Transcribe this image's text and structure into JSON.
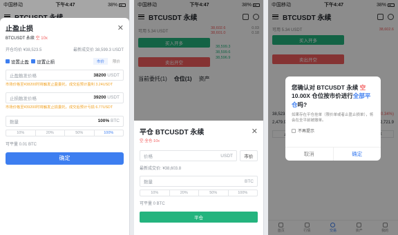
{
  "status": {
    "carrier": "中国移动",
    "time": "下午4:47",
    "battery": "38%"
  },
  "symbol": "BTCUSDT",
  "header": {
    "title": "BTCUSDT 永续"
  },
  "sl_dialog": {
    "title": "止盈止损",
    "subtitle_symbol": "BTCUSDT 永续",
    "subtitle_side": "空 10x",
    "open_price": "开仓均价 ¥38,523.5",
    "last_price": "最新成交价 38,599.3 USDT",
    "tp_check": "设置止盈",
    "sl_check": "设置止损",
    "tab_market": "市价",
    "tab_limit": "限价",
    "tp_label": "止盈触发价格",
    "tp_value": "38200",
    "unit": "USDT",
    "tp_hint": "市场价格至¥38200时将触发止盈委托，成交后预计盈利 3.24USDT",
    "sl_label": "止损触发价格",
    "sl_value": "39200",
    "sl_hint": "市场价格至¥39200时将触发止损委托，成交后预计亏损 6.77USDT",
    "qty_label": "数量",
    "qty_value": "100%",
    "qty_unit": "BTC",
    "percents": [
      "10%",
      "20%",
      "50%",
      "100%"
    ],
    "avail": "可平量 0.01 BTC",
    "confirm": "确定"
  },
  "panel2": {
    "balance": "可用 5.34 USDT",
    "buy_btn": "买入开多",
    "sell_btn": "卖出开空",
    "tabs": [
      "当前委托(1)",
      "仓位(1)",
      "资产"
    ],
    "book": [
      "38,602.6",
      "38,601.0",
      "38,599.3",
      "38,599.6",
      "38,596.9"
    ],
    "book_q": [
      "0.03",
      "0.18",
      "",
      "",
      ""
    ],
    "close_title": "平仓 BTCUSDT 永续",
    "close_sub": "空·全仓·10x",
    "price_label": "价格",
    "price_unit": "USDT",
    "market_btn": "市价",
    "last_price": "最新成交价: ¥38,603.8",
    "qty_label": "数量",
    "qty_unit": "BTC",
    "percents": [
      "10%",
      "20%",
      "50%",
      "100%"
    ],
    "avail": "可平量 0 BTC",
    "close_btn": "平仓"
  },
  "panel3": {
    "confirm_text_a": "您确认对 BTCUSDT 永续 ",
    "confirm_side": "空",
    "confirm_text_b": " 10.00X 仓位按市价进行",
    "confirm_full": "全部平仓",
    "confirm_text_c": "吗?",
    "notice": "如果存在平仓挂单（限价单或者止盈止损单），将会在全平前被撤单。",
    "no_remind": "不再提示",
    "cancel": "取消",
    "ok": "确定",
    "stat_pnl": "-0.78",
    "stat_ratio": "(-0.34%)",
    "stat_price": "38,523.5",
    "stat_size": "2,479.97%",
    "stat_liq": "42,721.9",
    "tp_btn": "止盈止损",
    "close_btn": "平仓",
    "market_close_btn": "市价全平",
    "tabs": [
      "首页",
      "行情",
      "交易",
      "资产",
      "我的"
    ]
  }
}
